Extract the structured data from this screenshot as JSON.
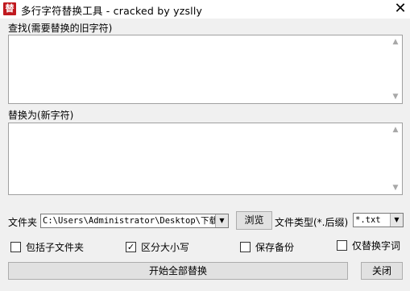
{
  "window": {
    "title": "多行字符替换工具 - cracked by yzslly",
    "icon_glyph": "替",
    "close_glyph": "✕"
  },
  "find": {
    "label": "查找(需要替换的旧字符)",
    "value": ""
  },
  "replace": {
    "label": "替换为(新字符)",
    "value": ""
  },
  "folder": {
    "label": "文件夹",
    "value": "C:\\Users\\Administrator\\Desktop\\下载)",
    "browse_label": "浏览"
  },
  "filetype": {
    "label": "文件类型(*.后缀)",
    "value": "*.txt"
  },
  "options": {
    "include_subfolders": {
      "label": "包括子文件夹",
      "checked": false
    },
    "case_sensitive": {
      "label": "区分大小写",
      "checked": true
    },
    "save_backup": {
      "label": "保存备份",
      "checked": false
    },
    "whole_word": {
      "label": "仅替换字词",
      "checked": false
    }
  },
  "actions": {
    "start_label": "开始全部替换",
    "close_label": "关闭"
  },
  "icons": {
    "scroll_up": "▲",
    "scroll_down": "▼",
    "dropdown": "▼",
    "check": "✓"
  }
}
